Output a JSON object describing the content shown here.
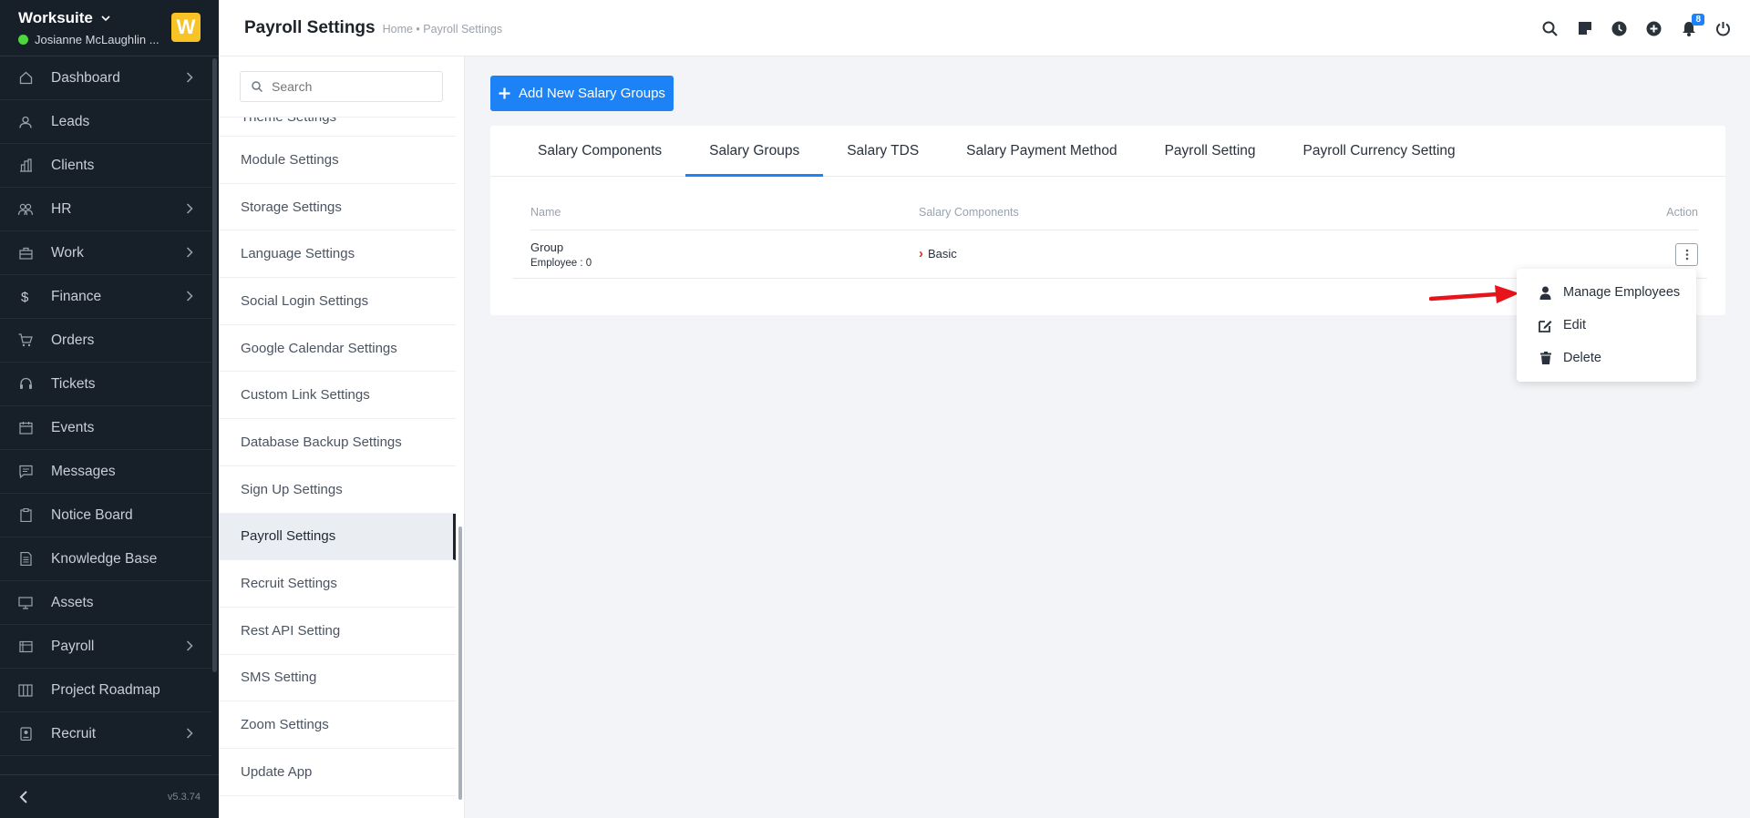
{
  "app": {
    "brand_name": "Worksuite",
    "user_name": "Josianne McLaughlin ...",
    "logo_letter": "W",
    "version": "v5.3.74",
    "online_color": "#4fd63c",
    "accent_color": "#1d82f5"
  },
  "sidebar": {
    "items": [
      {
        "label": "Dashboard",
        "icon": "home-icon",
        "has_children": true
      },
      {
        "label": "Leads",
        "icon": "user-icon",
        "has_children": false
      },
      {
        "label": "Clients",
        "icon": "building-icon",
        "has_children": false
      },
      {
        "label": "HR",
        "icon": "people-icon",
        "has_children": true
      },
      {
        "label": "Work",
        "icon": "briefcase-icon",
        "has_children": true
      },
      {
        "label": "Finance",
        "icon": "dollar-icon",
        "has_children": true
      },
      {
        "label": "Orders",
        "icon": "cart-icon",
        "has_children": false
      },
      {
        "label": "Tickets",
        "icon": "headset-icon",
        "has_children": false
      },
      {
        "label": "Events",
        "icon": "calendar-icon",
        "has_children": false
      },
      {
        "label": "Messages",
        "icon": "message-icon",
        "has_children": false
      },
      {
        "label": "Notice Board",
        "icon": "clipboard-icon",
        "has_children": false
      },
      {
        "label": "Knowledge Base",
        "icon": "document-icon",
        "has_children": false
      },
      {
        "label": "Assets",
        "icon": "monitor-icon",
        "has_children": false
      },
      {
        "label": "Payroll",
        "icon": "wallet-icon",
        "has_children": true
      },
      {
        "label": "Project Roadmap",
        "icon": "columns-icon",
        "has_children": false
      },
      {
        "label": "Recruit",
        "icon": "id-badge-icon",
        "has_children": true
      }
    ]
  },
  "header": {
    "title": "Payroll Settings",
    "breadcrumb": "Home • Payroll Settings",
    "notification_count": "8"
  },
  "settings_menu": {
    "search_placeholder": "Search",
    "items": [
      {
        "label": "Theme Settings",
        "partial": true
      },
      {
        "label": "Module Settings"
      },
      {
        "label": "Storage Settings"
      },
      {
        "label": "Language Settings"
      },
      {
        "label": "Social Login Settings"
      },
      {
        "label": "Google Calendar Settings"
      },
      {
        "label": "Custom Link Settings"
      },
      {
        "label": "Database Backup Settings"
      },
      {
        "label": "Sign Up Settings"
      },
      {
        "label": "Payroll Settings",
        "active": true
      },
      {
        "label": "Recruit Settings"
      },
      {
        "label": "Rest API Setting"
      },
      {
        "label": "SMS Setting"
      },
      {
        "label": "Zoom Settings"
      },
      {
        "label": "Update App"
      }
    ]
  },
  "content": {
    "add_button_label": "Add New Salary Groups",
    "tabs": [
      {
        "label": "Salary Components"
      },
      {
        "label": "Salary Groups",
        "active": true
      },
      {
        "label": "Salary TDS"
      },
      {
        "label": "Salary Payment Method"
      },
      {
        "label": "Payroll Setting"
      },
      {
        "label": "Payroll Currency Setting"
      }
    ],
    "table": {
      "columns": [
        "Name",
        "Salary Components",
        "Action"
      ],
      "rows": [
        {
          "name": "Group",
          "sub": "Employee : 0",
          "component": "Basic"
        }
      ]
    },
    "dropdown": {
      "items": [
        {
          "label": "Manage Employees",
          "icon": "person-icon"
        },
        {
          "label": "Edit",
          "icon": "edit-icon"
        },
        {
          "label": "Delete",
          "icon": "trash-icon"
        }
      ]
    }
  }
}
